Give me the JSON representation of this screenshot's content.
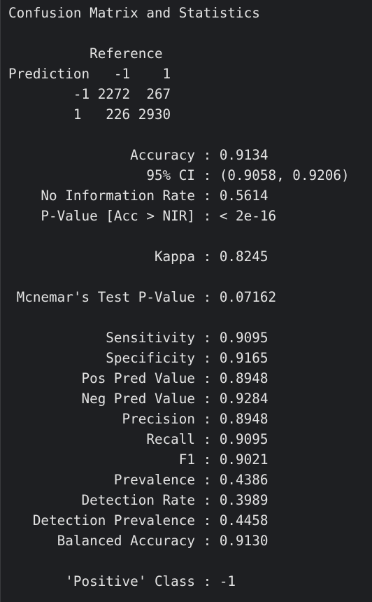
{
  "terminal": {
    "lines": [
      "Confusion Matrix and Statistics",
      "",
      "          Reference",
      "Prediction   -1    1",
      "        -1 2272  267",
      "        1   226 2930",
      "",
      "               Accuracy : 0.9134",
      "                 95% CI : (0.9058, 0.9206)",
      "    No Information Rate : 0.5614",
      "    P-Value [Acc > NIR] : < 2e-16",
      "",
      "                  Kappa : 0.8245",
      "",
      " Mcnemar's Test P-Value : 0.07162",
      "",
      "            Sensitivity : 0.9095",
      "            Specificity : 0.9165",
      "         Pos Pred Value : 0.8948",
      "         Neg Pred Value : 0.9284",
      "              Precision : 0.8948",
      "                 Recall : 0.9095",
      "                     F1 : 0.9021",
      "             Prevalence : 0.4386",
      "         Detection Rate : 0.3989",
      "   Detection Prevalence : 0.4458",
      "      Balanced Accuracy : 0.9130",
      "",
      "       'Positive' Class : -1"
    ]
  }
}
